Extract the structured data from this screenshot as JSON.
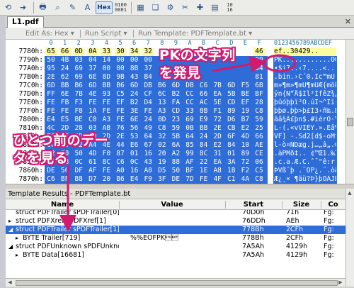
{
  "toolbar": {
    "icons": [
      "undo-arrow",
      "redo-arrow",
      "print",
      "find",
      "highlighter",
      "replace",
      "hex-mode",
      "binary-mode",
      "calculator",
      "script",
      "histogram",
      "tools",
      "calc-2",
      "hex-10-16"
    ],
    "hex_label": "Hex",
    "small_label_1": "0100 0001",
    "small_label_2": "10 16"
  },
  "tab": {
    "label": "L1.pdf",
    "close": "✕"
  },
  "options": {
    "edit_as": "Edit As: Hex ▾",
    "run_script": "Run Script ▾",
    "run_template": "Run Template: PDFTemplate.bt ▾"
  },
  "hex": {
    "header_columns": [
      "0",
      "1",
      "2",
      "3",
      "4",
      "5",
      "6",
      "7",
      "8",
      "9",
      "A",
      "B",
      "C",
      "D",
      "E",
      "F"
    ],
    "ascii_header": "0123456789ABCDEF",
    "rows": [
      {
        "addr": "7780h:",
        "bytes": [
          "65",
          "66",
          "0D",
          "0A",
          "33",
          "30",
          "34",
          "32",
          "",
          "",
          "",
          "",
          "",
          "",
          "",
          "46"
        ],
        "ascii": "ef..30429.."
      },
      {
        "addr": "7790h:",
        "bytes": [
          "50",
          "4B",
          "03",
          "04",
          "14",
          "00",
          "00",
          "00",
          "",
          "",
          "",
          "",
          "",
          "",
          "",
          "00"
        ],
        "ascii": "PK............Ó®cAr"
      },
      {
        "addr": "77A0h:",
        "bytes": [
          "95",
          "24",
          "69",
          "37",
          "00",
          "00",
          "8B",
          "37",
          "",
          "",
          "",
          "",
          "",
          "",
          "",
          "34"
        ],
        "ascii": "•$i7..‹7....<.....4"
      },
      {
        "addr": "77B0h:",
        "bytes": [
          "2E",
          "62",
          "69",
          "6E",
          "8D",
          "9B",
          "43",
          "B4",
          "",
          "",
          "",
          "",
          "",
          "",
          "",
          "81"
        ],
        "ascii": ".bin.›C´0.Ïc™mÜ."
      },
      {
        "addr": "77C0h:",
        "bytes": [
          "6D",
          "BB",
          "B6",
          "6D",
          "BB",
          "B6",
          "6D",
          "DB",
          "B6",
          "6D",
          "DB",
          "C6",
          "7B",
          "6D",
          "F5",
          "6B"
        ],
        "ascii": "m»¶m»¶mÛ¶mÛÆ{mõk"
      },
      {
        "addr": "77D0h:",
        "bytes": [
          "FF",
          "6E",
          "7B",
          "4E",
          "93",
          "C5",
          "24",
          "CF",
          "6C",
          "B2",
          "CC",
          "66",
          "EA",
          "5B",
          "BE",
          "BF"
        ],
        "ascii": "ÿn{N“Å$Ïl²ÌfêZ¾¿"
      },
      {
        "addr": "77E0h:",
        "bytes": [
          "FE",
          "FB",
          "F3",
          "FE",
          "FE",
          "EF",
          "B2",
          "D4",
          "13",
          "FA",
          "CC",
          "AC",
          "5E",
          "CD",
          "EF",
          "28"
        ],
        "ascii": "þûóþþï²Ô.úÌ¬^Íï("
      },
      {
        "addr": "77F0h:",
        "bytes": [
          "FE",
          "FE",
          "F8",
          "1A",
          "FE",
          "FE",
          "3E",
          "FE",
          "A3",
          "CD",
          "33",
          "8B",
          "F1",
          "89",
          "19",
          "C8"
        ],
        "ascii": "þþø.þþ>þ£Í3‹ñ‰.È"
      },
      {
        "addr": "7800h:",
        "bytes": [
          "E4",
          "E5",
          "BE",
          "C0",
          "A3",
          "FE",
          "6E",
          "24",
          "0D",
          "23",
          "69",
          "E9",
          "72",
          "D6",
          "B7",
          "59"
        ],
        "ascii": "äå¾À£þn$.#iérÖ·Y"
      },
      {
        "addr": "7810h:",
        "bytes": [
          "4C",
          "2D",
          "28",
          "03",
          "AB",
          "76",
          "56",
          "49",
          "C8",
          "59",
          "0B",
          "BB",
          "2E",
          "CB",
          "E2",
          "25"
        ],
        "ascii": "L-(.«vVIÈY.».Ëâ%"
      },
      {
        "addr": "7820h:",
        "bytes": [
          "56",
          "46",
          "5D",
          "20",
          "2D",
          "2E",
          "53",
          "64",
          "32",
          "5B",
          "64",
          "24",
          "2D",
          "6F",
          "4D",
          "66"
        ],
        "ascii": "VF] -.Sd2[d$-oMf"
      },
      {
        "addr": "7830h:",
        "bytes": [
          "6C",
          "2D",
          "F2",
          "A4",
          "4E",
          "44",
          "E6",
          "67",
          "02",
          "6A",
          "85",
          "84",
          "E2",
          "84",
          "10",
          "AE"
        ],
        "ascii": "l-ò¤NDæg.j…„â„.®"
      },
      {
        "addr": "7840h:",
        "bytes": [
          "12",
          "E0",
          "50",
          "4D",
          "F0",
          "87",
          "01",
          "16",
          "20",
          "A2",
          "99",
          "8C",
          "31",
          "01",
          "89",
          "CE"
        ],
        "ascii": ".àPMð‡.. ¢™Œ1.‰Î"
      },
      {
        "addr": "7850h:",
        "bytes": [
          "0C",
          "63",
          "0C",
          "61",
          "8C",
          "C6",
          "0C",
          "43",
          "19",
          "88",
          "AF",
          "22",
          "EA",
          "3A",
          "72",
          "06"
        ],
        "ascii": ".c.a.Æ.C.ˆ¯\"ê:r."
      },
      {
        "addr": "7860h:",
        "bytes": [
          "DE",
          "56",
          "DF",
          "AF",
          "FE",
          "A0",
          "16",
          "A8",
          "D5",
          "50",
          "BF",
          "1E",
          "A8",
          "1B",
          "F2",
          "C5"
        ],
        "ascii": "ÞVß¯þ .¨ÕP¿.¨.òÅ"
      },
      {
        "addr": "7870h:",
        "bytes": [
          "C6",
          "BF",
          "B8",
          "D7",
          "20",
          "B6",
          "E4",
          "F9",
          "3F",
          "DE",
          "7D",
          "FE",
          "4F",
          "C1",
          "4A",
          "C8"
        ],
        "ascii": "Æ¿¸× ¶äù?Þ}þOÁJÈ"
      }
    ]
  },
  "annotations": {
    "pk_found_line1": "PKの文字列",
    "pk_found_line2": "を発見",
    "prev_data_line1": "ひとつ前のデー",
    "prev_data_line2": "タを見る"
  },
  "template_results": {
    "title": "Template Results - PDFTemplate.bt",
    "columns": [
      "Name",
      "Value",
      "Start",
      "Size",
      "Co"
    ],
    "rows": [
      {
        "expander": "",
        "name": "struct PDFTrailer sPDFTrailer[0]",
        "value": "",
        "start": "70D0h",
        "size": "71h",
        "color": "Fg:"
      },
      {
        "expander": "▸",
        "name": "struct PDFXref sPDFXref[1]",
        "value": "",
        "start": "76DDh",
        "size": "AEh",
        "color": "Fg:"
      },
      {
        "expander": "◢",
        "name": "struct PDFTrailer sPDFTrailer[1]",
        "value": "",
        "start": "778Bh",
        "size": "2CFh",
        "color": "Fg:"
      },
      {
        "expander": "▸",
        "name": "BYTE Trailer[719]",
        "value": "%%EOFPK\u0003\u0004",
        "start": "778Bh",
        "size": "2CFh",
        "color": "Fg:"
      },
      {
        "expander": "◢",
        "name": "struct PDFUnknown sPDFUnknown",
        "value": "",
        "start": "7A5Ah",
        "size": "4129h",
        "color": "Fg:"
      },
      {
        "expander": "▸",
        "name": "BYTE Data[16681]",
        "value": "",
        "start": "7A5Ah",
        "size": "4129h",
        "color": "Fg:"
      }
    ]
  },
  "colors": {
    "selection": "#2e6cd8",
    "highlight_yellow": "#fcfb9e",
    "annotation_magenta": "#d21a6e",
    "offset_header": "#1b6e91"
  }
}
